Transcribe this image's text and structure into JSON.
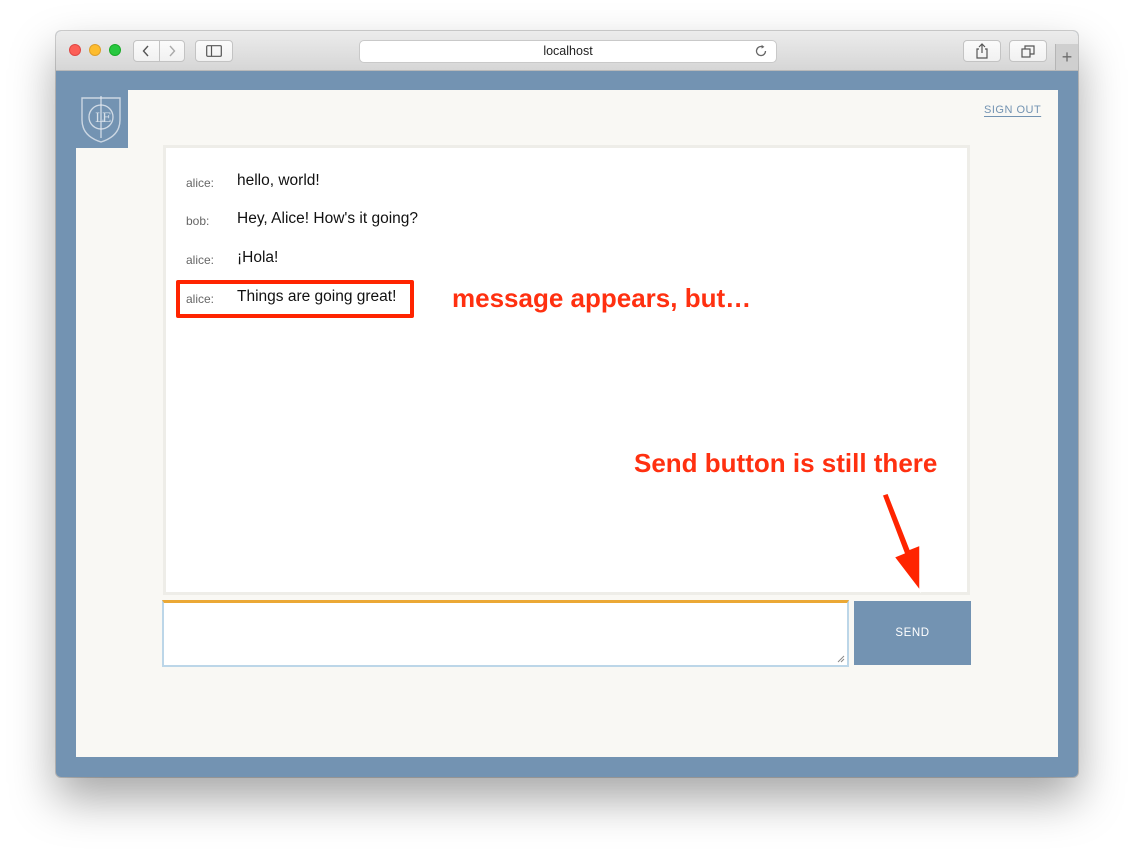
{
  "browser": {
    "url": "localhost"
  },
  "header": {
    "sign_out_label": "SIGN OUT"
  },
  "messages": [
    {
      "author": "alice:",
      "text": "hello, world!"
    },
    {
      "author": "bob:",
      "text": "Hey, Alice! How's it going?"
    },
    {
      "author": "alice:",
      "text": "¡Hola!"
    },
    {
      "author": "alice:",
      "text": "Things are going great!"
    }
  ],
  "composer": {
    "value": "",
    "send_label": "SEND"
  },
  "annotations": {
    "message_note": "message appears, but…",
    "send_note": "Send button is still there"
  },
  "colors": {
    "accent": "#7393b2",
    "focus_bar": "#eba835",
    "annotation": "#ff3010"
  },
  "icons": {
    "back": "chevron-left-icon",
    "forward": "chevron-right-icon",
    "sidebar": "sidebar-icon",
    "reload": "reload-icon",
    "share": "share-icon",
    "tabs": "tabs-icon",
    "new_tab": "plus-icon",
    "logo": "shield-logo-icon"
  }
}
